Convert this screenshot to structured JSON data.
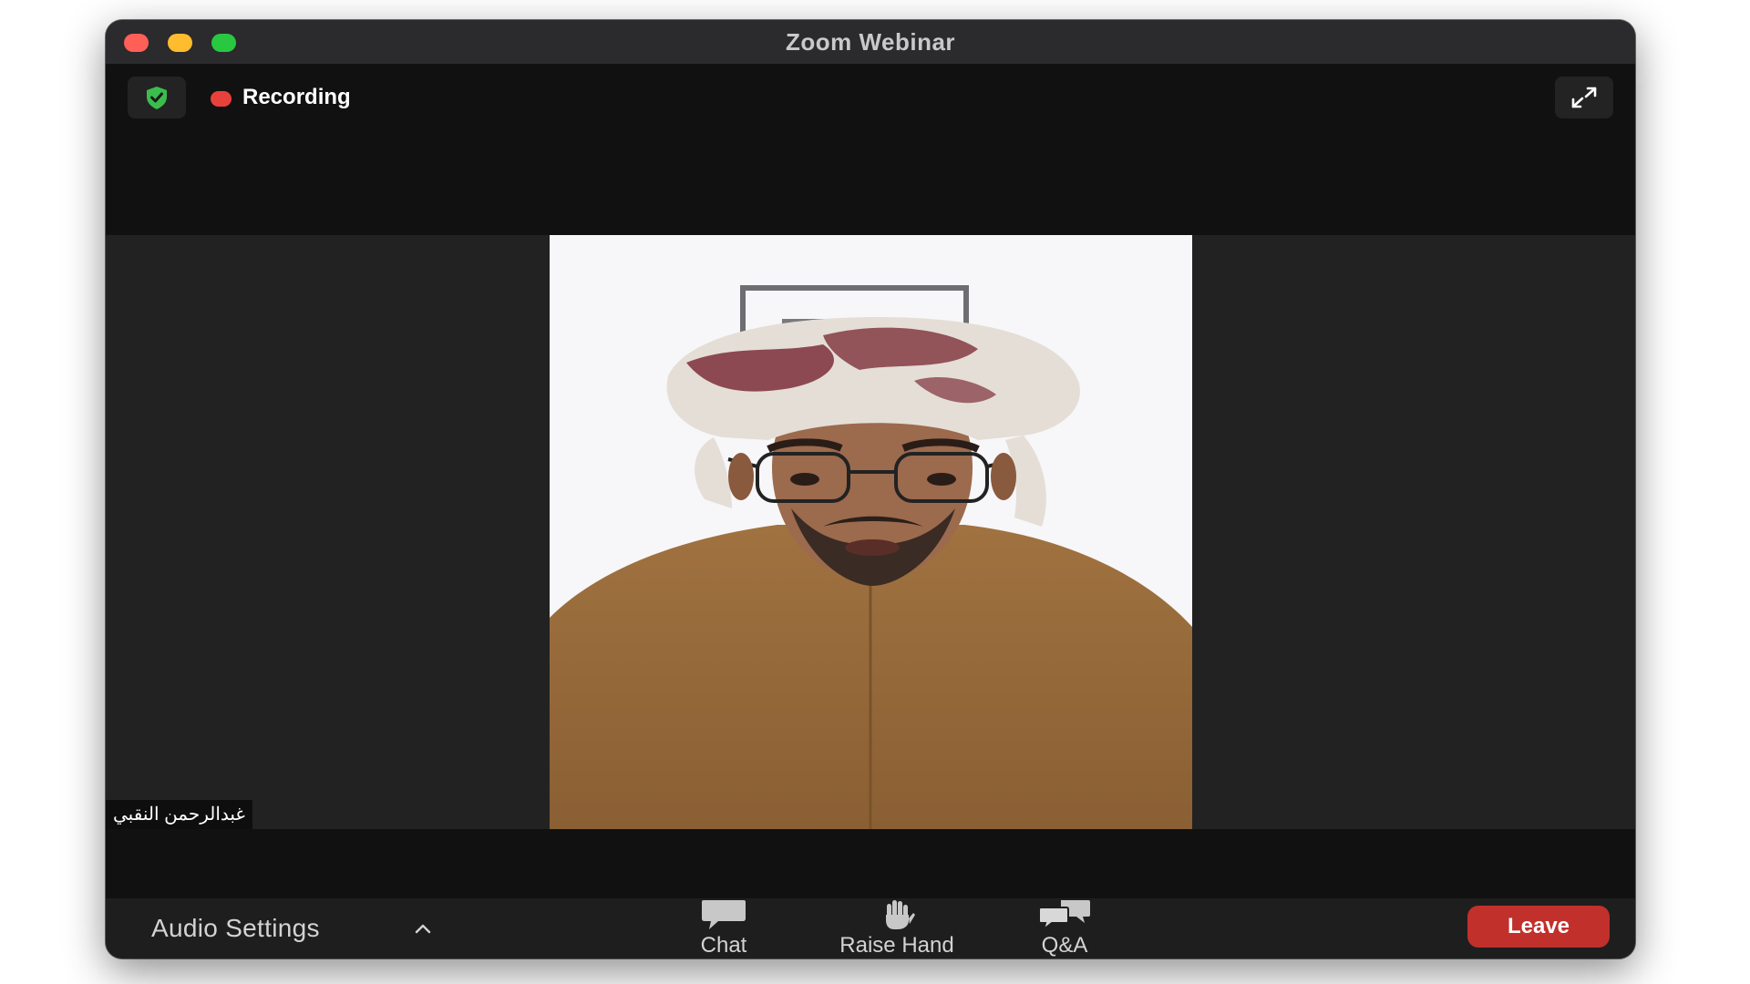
{
  "window": {
    "title": "Zoom Webinar"
  },
  "top_bar": {
    "shield_icon": "shield-check-icon",
    "recording_label": "Recording",
    "recording_color": "#e8413c",
    "fullscreen_icon": "expand-arrows-icon"
  },
  "stage": {
    "participant_name": "غبدالرحمن النقبي"
  },
  "toolbar": {
    "audio_settings_label": "Audio Settings",
    "chat_label": "Chat",
    "raise_hand_label": "Raise Hand",
    "qa_label": "Q&A",
    "leave_label": "Leave",
    "leave_color": "#c1302b"
  }
}
